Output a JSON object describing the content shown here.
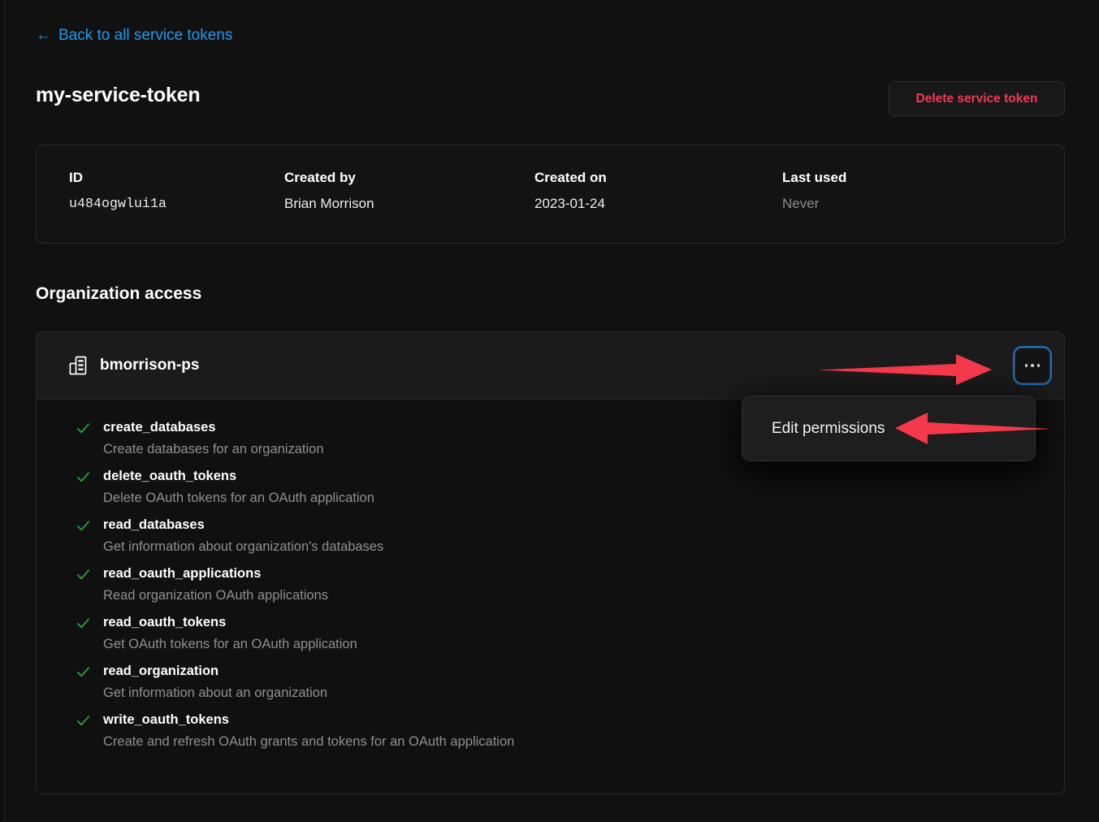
{
  "back_link": {
    "label": "Back to all service tokens",
    "icon": "arrow-left-icon"
  },
  "header": {
    "title": "my-service-token",
    "delete_button": "Delete service token"
  },
  "info_card": {
    "fields": [
      {
        "label": "ID",
        "value": "u484ogwlui1a"
      },
      {
        "label": "Created by",
        "value": "Brian Morrison"
      },
      {
        "label": "Created on",
        "value": "2023-01-24"
      },
      {
        "label": "Last used",
        "value": "Never"
      }
    ]
  },
  "organization_access": {
    "heading": "Organization access",
    "org_name": "bmorrison-ps",
    "org_icon": "organization-building-icon",
    "kebab_icon": "more-options-icon",
    "permissions": [
      {
        "name": "create_databases",
        "description": "Create databases for an organization",
        "granted": true
      },
      {
        "name": "delete_oauth_tokens",
        "description": "Delete OAuth tokens for an OAuth application",
        "granted": true
      },
      {
        "name": "read_databases",
        "description": "Get information about organization's databases",
        "granted": true
      },
      {
        "name": "read_oauth_applications",
        "description": "Read organization OAuth applications",
        "granted": true
      },
      {
        "name": "read_oauth_tokens",
        "description": "Get OAuth tokens for an OAuth application",
        "granted": true
      },
      {
        "name": "read_organization",
        "description": "Get information about an organization",
        "granted": true
      },
      {
        "name": "write_oauth_tokens",
        "description": "Create and refresh OAuth grants and tokens for an OAuth application",
        "granted": true
      }
    ]
  },
  "dropdown_menu": {
    "items": [
      {
        "label": "Edit permissions"
      }
    ]
  },
  "annotations": [
    {
      "name": "arrow-to-more-options",
      "direction": "right",
      "color": "#F4394B"
    },
    {
      "name": "arrow-to-edit-permissions",
      "direction": "left",
      "color": "#F4394B"
    }
  ],
  "colors": {
    "page_background": "#111111",
    "link_blue": "#1f9cf0",
    "danger_red": "#f2385a",
    "check_green": "#2ea043",
    "focus_ring_blue": "#1a6ec0",
    "annotation_red": "#F4394B"
  }
}
